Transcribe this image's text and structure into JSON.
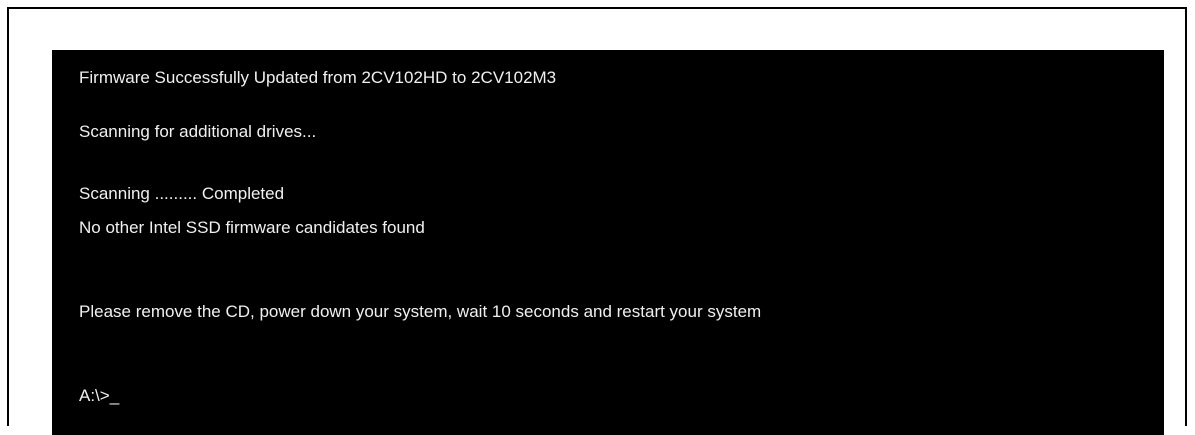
{
  "console": {
    "lines": [
      "Firmware Successfully Updated from 2CV102HD to 2CV102M3",
      "Scanning for additional drives...",
      "Scanning ......... Completed",
      "No other Intel SSD firmware candidates found",
      "Please remove the CD, power down your system, wait 10 seconds and restart your system"
    ],
    "prompt": "A:\\>",
    "cursor": "_"
  }
}
